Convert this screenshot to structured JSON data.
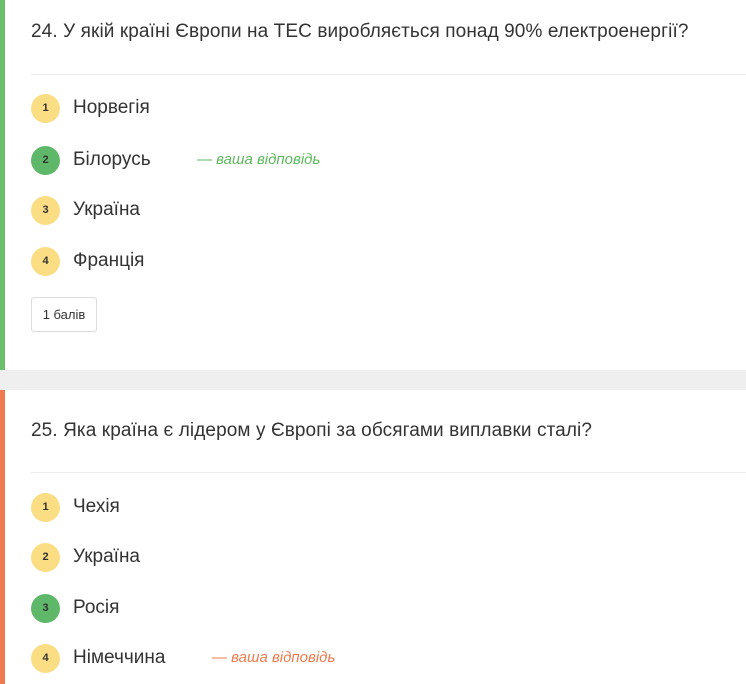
{
  "questions": [
    {
      "title": "24. У якій країні Європи на ТЕС виробляється понад 90% електроенергії?",
      "status_color": "#6abf69",
      "options": [
        {
          "number": "1",
          "label": "Норвегія"
        },
        {
          "number": "2",
          "label": "Білорусь"
        },
        {
          "number": "3",
          "label": "Україна"
        },
        {
          "number": "4",
          "label": "Франція"
        }
      ],
      "correct_option": "2",
      "selected_option": "2",
      "your_answer_label": "— ваша відповідь",
      "your_answer_color": "#5cb85c",
      "points_label": "1 балів"
    },
    {
      "title": "25. Яка країна є лідером у Європі за обсягами виплавки сталі?",
      "status_color": "#ef7a4f",
      "options": [
        {
          "number": "1",
          "label": "Чехія"
        },
        {
          "number": "2",
          "label": "Україна"
        },
        {
          "number": "3",
          "label": "Росія"
        },
        {
          "number": "4",
          "label": "Німеччина"
        }
      ],
      "correct_option": "3",
      "selected_option": "4",
      "your_answer_label": "— ваша відповідь",
      "your_answer_color": "#ef7a4f"
    }
  ],
  "colors": {
    "option_badge": "#fbdd83",
    "correct_badge": "#5fb869",
    "separator": "#efefef"
  }
}
